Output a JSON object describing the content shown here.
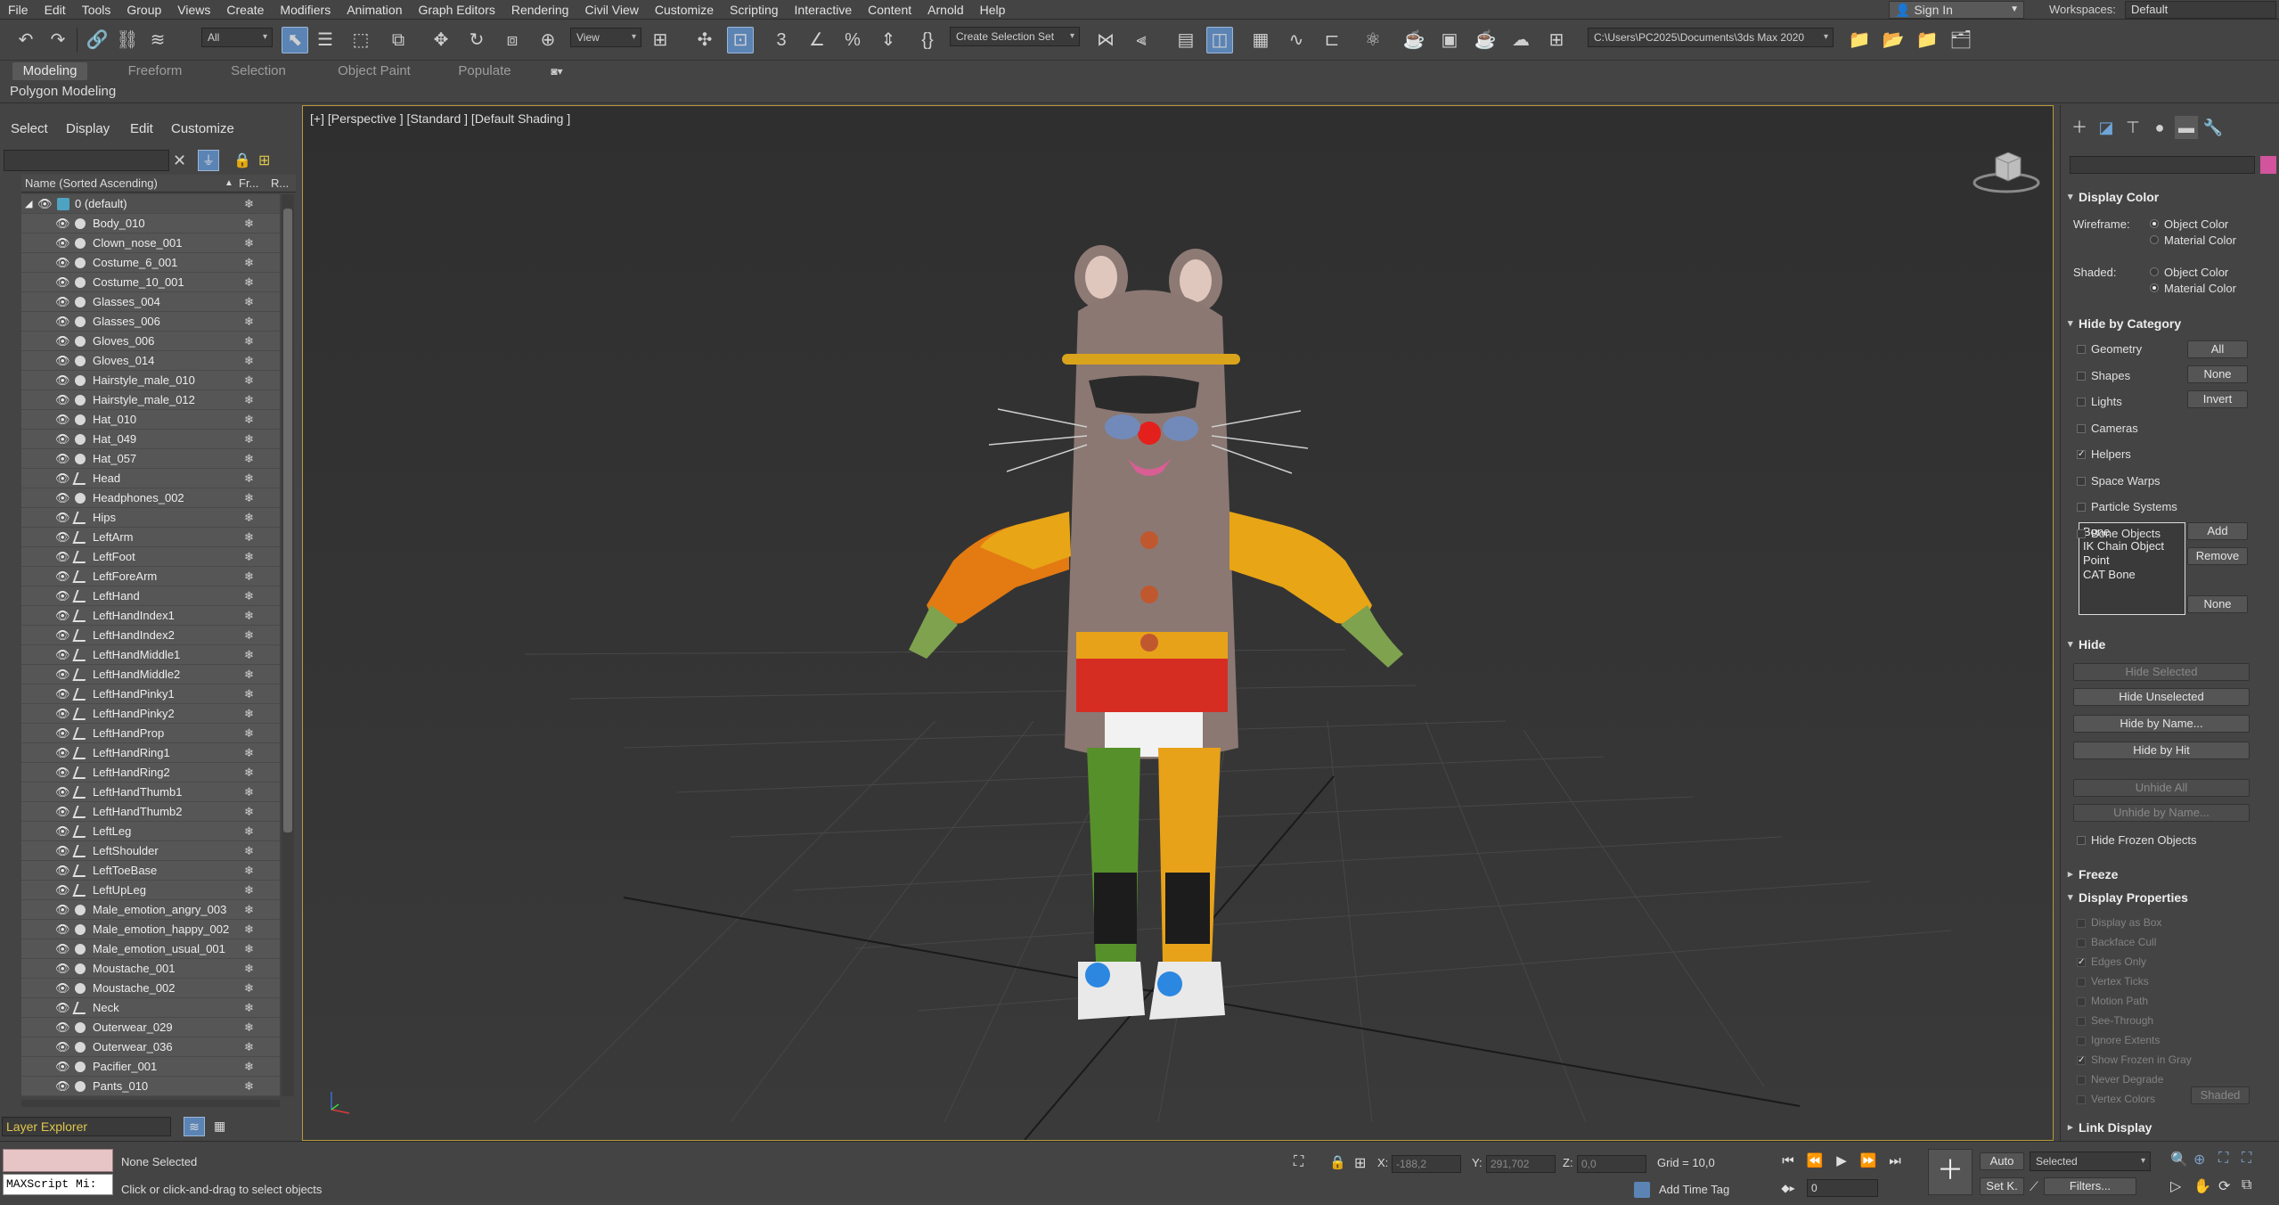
{
  "menu": [
    "File",
    "Edit",
    "Tools",
    "Group",
    "Views",
    "Create",
    "Modifiers",
    "Animation",
    "Graph Editors",
    "Rendering",
    "Civil View",
    "Customize",
    "Scripting",
    "Interactive",
    "Content",
    "Arnold",
    "Help"
  ],
  "account": {
    "signin": "Sign In",
    "workspaces_label": "Workspaces:",
    "workspace": "Default"
  },
  "toolbar": {
    "filter": "All",
    "refcoord": "View",
    "selection_set": "Create Selection Set",
    "project_path": "C:\\Users\\PC2025\\Documents\\3ds Max 2020"
  },
  "ribbon": {
    "tabs": [
      "Modeling",
      "Freeform",
      "Selection",
      "Object Paint",
      "Populate"
    ],
    "active": "Modeling",
    "sub": "Polygon Modeling"
  },
  "explorer": {
    "menu": [
      "Select",
      "Display",
      "Edit",
      "Customize"
    ],
    "columns": {
      "name": "Name (Sorted Ascending)",
      "frozen": "Fr...",
      "render": "R..."
    },
    "layer": "0 (default)",
    "items": [
      {
        "name": "Body_010",
        "type": "geo"
      },
      {
        "name": "Clown_nose_001",
        "type": "geo"
      },
      {
        "name": "Costume_6_001",
        "type": "geo"
      },
      {
        "name": "Costume_10_001",
        "type": "geo"
      },
      {
        "name": "Glasses_004",
        "type": "geo"
      },
      {
        "name": "Glasses_006",
        "type": "geo"
      },
      {
        "name": "Gloves_006",
        "type": "geo"
      },
      {
        "name": "Gloves_014",
        "type": "geo"
      },
      {
        "name": "Hairstyle_male_010",
        "type": "geo"
      },
      {
        "name": "Hairstyle_male_012",
        "type": "geo"
      },
      {
        "name": "Hat_010",
        "type": "geo"
      },
      {
        "name": "Hat_049",
        "type": "geo"
      },
      {
        "name": "Hat_057",
        "type": "geo"
      },
      {
        "name": "Head",
        "type": "bone"
      },
      {
        "name": "Headphones_002",
        "type": "geo"
      },
      {
        "name": "Hips",
        "type": "bone"
      },
      {
        "name": "LeftArm",
        "type": "bone"
      },
      {
        "name": "LeftFoot",
        "type": "bone"
      },
      {
        "name": "LeftForeArm",
        "type": "bone"
      },
      {
        "name": "LeftHand",
        "type": "bone"
      },
      {
        "name": "LeftHandIndex1",
        "type": "bone"
      },
      {
        "name": "LeftHandIndex2",
        "type": "bone"
      },
      {
        "name": "LeftHandMiddle1",
        "type": "bone"
      },
      {
        "name": "LeftHandMiddle2",
        "type": "bone"
      },
      {
        "name": "LeftHandPinky1",
        "type": "bone"
      },
      {
        "name": "LeftHandPinky2",
        "type": "bone"
      },
      {
        "name": "LeftHandProp",
        "type": "bone"
      },
      {
        "name": "LeftHandRing1",
        "type": "bone"
      },
      {
        "name": "LeftHandRing2",
        "type": "bone"
      },
      {
        "name": "LeftHandThumb1",
        "type": "bone"
      },
      {
        "name": "LeftHandThumb2",
        "type": "bone"
      },
      {
        "name": "LeftLeg",
        "type": "bone"
      },
      {
        "name": "LeftShoulder",
        "type": "bone"
      },
      {
        "name": "LeftToeBase",
        "type": "bone"
      },
      {
        "name": "LeftUpLeg",
        "type": "bone"
      },
      {
        "name": "Male_emotion_angry_003",
        "type": "geo"
      },
      {
        "name": "Male_emotion_happy_002",
        "type": "geo"
      },
      {
        "name": "Male_emotion_usual_001",
        "type": "geo"
      },
      {
        "name": "Moustache_001",
        "type": "geo"
      },
      {
        "name": "Moustache_002",
        "type": "geo"
      },
      {
        "name": "Neck",
        "type": "bone"
      },
      {
        "name": "Outerwear_029",
        "type": "geo"
      },
      {
        "name": "Outerwear_036",
        "type": "geo"
      },
      {
        "name": "Pacifier_001",
        "type": "geo"
      },
      {
        "name": "Pants_010",
        "type": "geo"
      }
    ],
    "layer_explorer": "Layer Explorer"
  },
  "viewport": {
    "label": "[+] [Perspective ] [Standard ] [Default Shading ]"
  },
  "panel": {
    "display_color": {
      "title": "Display Color",
      "wireframe": "Wireframe:",
      "shaded": "Shaded:",
      "object_color": "Object Color",
      "material_color": "Material Color",
      "swatch": "#d1549c"
    },
    "hide_by_category": {
      "title": "Hide by Category",
      "cats": [
        "Geometry",
        "Shapes",
        "Lights",
        "Cameras",
        "Helpers",
        "Space Warps",
        "Particle Systems",
        "Bone Objects"
      ],
      "checked": "Helpers",
      "btn_all": "All",
      "btn_none": "None",
      "btn_invert": "Invert",
      "list": [
        "Bone",
        "IK Chain Object",
        "Point",
        "CAT Bone"
      ],
      "btn_add": "Add",
      "btn_remove": "Remove",
      "btn_none2": "None"
    },
    "hide": {
      "title": "Hide",
      "hide_selected": "Hide Selected",
      "hide_unselected": "Hide Unselected",
      "hide_by_name": "Hide by Name...",
      "hide_by_hit": "Hide by Hit",
      "unhide_all": "Unhide All",
      "unhide_by_name": "Unhide by Name...",
      "hide_frozen": "Hide Frozen Objects"
    },
    "freeze": {
      "title": "Freeze"
    },
    "display_properties": {
      "title": "Display Properties",
      "items": [
        "Display as Box",
        "Backface Cull",
        "Edges Only",
        "Vertex Ticks",
        "Motion Path",
        "See-Through",
        "Ignore Extents",
        "Show Frozen in Gray",
        "Never Degrade",
        "Vertex Colors"
      ],
      "checked": [
        "Edges Only",
        "Show Frozen in Gray"
      ],
      "shaded_btn": "Shaded"
    },
    "link_display": {
      "title": "Link Display"
    }
  },
  "status": {
    "maxscript": "MAXScript Mi:",
    "selection": "None Selected",
    "prompt": "Click or click-and-drag to select objects",
    "x_label": "X:",
    "x": "-188,2",
    "y_label": "Y:",
    "y": "291,702",
    "z_label": "Z:",
    "z": "0,0",
    "grid": "Grid = 10,0",
    "add_time_tag": "Add Time Tag",
    "auto": "Auto",
    "selected": "Selected",
    "setk": "Set K.",
    "filters": "Filters...",
    "frame": "0"
  }
}
